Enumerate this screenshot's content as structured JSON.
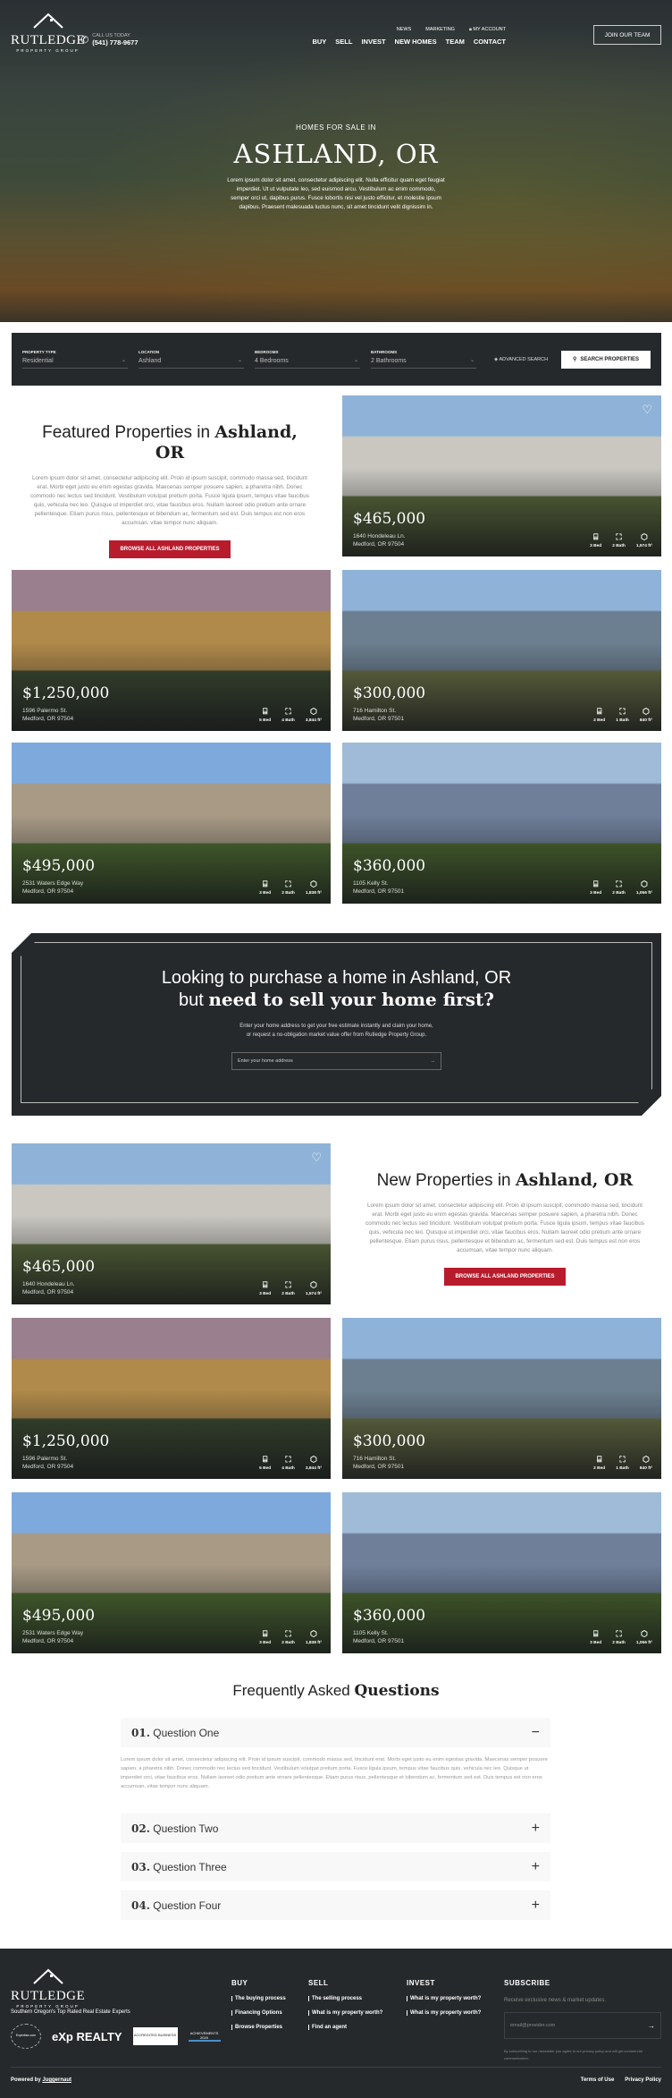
{
  "brand": {
    "name": "RUTLEDGE",
    "sub": "PROPERTY GROUP"
  },
  "header": {
    "call_label": "CALL US TODAY",
    "phone": "(541) 778-9677",
    "top_links": [
      "NEWS",
      "MARKETING",
      "MY ACCOUNT"
    ],
    "nav": [
      "BUY",
      "SELL",
      "INVEST",
      "NEW HOMES",
      "TEAM",
      "CONTACT"
    ],
    "join": "JOIN OUR TEAM"
  },
  "hero": {
    "eyebrow": "HOMES FOR SALE IN",
    "title": "ASHLAND, OR",
    "text": "Lorem ipsum dolor sit amet, consectetur adipiscing elit. Nulla efficitur quam eget feugiat imperdiet. Ut ut vulputate leo, sed euismod arcu. Vestibulum ac enim commodo, semper orci ut, dapibus purus. Fusce lobortis nisi vel justo efficitur, et molestie ipsum dapibus. Praesent malesuada luctus nunc, sit amet tincidunt velit dignissim in."
  },
  "search": {
    "fields": [
      {
        "label": "PROPERTY TYPE",
        "value": "Residential"
      },
      {
        "label": "LOCATION",
        "value": "Ashland"
      },
      {
        "label": "BEDROOMS",
        "value": "4 Bedrooms"
      },
      {
        "label": "BATHROOMS",
        "value": "2 Bathrooms"
      }
    ],
    "advanced": "ADVANCED SEARCH",
    "button": "SEARCH PROPERTIES"
  },
  "featured": {
    "title_a": "Featured Properties in ",
    "title_b": "Ashland, OR",
    "text": "Lorem ipsum dolor sit amet, consectetur adipiscing elit. Proin id ipsum suscipit, commodo massa sed, tincidunt erat. Morbi eget justo eu enim egestas gravida. Maecenas semper posuere sapien, a pharetra nibh. Donec commodo nec lectus sed tincidunt. Vestibulum volutpat pretium porta. Fusce ligula ipsum, tempus vitae faucibus quis, vehicula nec leo. Quisque ut imperdiet orci, vitae faucibus eros. Nullam laoreet odio pretium ante ornare pellentesque. Etiam purus risus, pellentesque et bibendum ac, fermentum sed est. Duis tempus est non eros accumsan, vitae tempor nunc aliquam.",
    "button": "BROWSE ALL ASHLAND PROPERTIES"
  },
  "newprops": {
    "title_a": "New Properties in ",
    "title_b": "Ashland, OR",
    "text": "Lorem ipsum dolor sit amet, consectetur adipiscing elit. Proin id ipsum suscipit, commodo massa sed, tincidunt erat. Morbi eget justo eu enim egestas gravida. Maecenas semper posuere sapien, a pharetra nibh. Donec commodo nec lectus sed tincidunt. Vestibulum volutpat pretium porta. Fusce ligula ipsum, tempus vitae faucibus quis, vehicula nec leo. Quisque ut imperdiet orci, vitae faucibus eros. Nullam laoreet odio pretium ante ornare pellentesque. Etiam purus risus, pellentesque et bibendum ac, fermentum sed est. Duis tempus est non eros accumsan, vitae tempor nunc aliquam.",
    "button": "BROWSE ALL ASHLAND PROPERTIES"
  },
  "properties": [
    {
      "price": "$465,000",
      "street": "1640 Hondeleau Ln.",
      "city": "Medford, OR 97504",
      "bed": "3 Bed",
      "bath": "2 Bath",
      "area": "1,574 ft²",
      "colors": [
        "#8fb3d8",
        "#c9c7c0",
        "#5b6b3a"
      ]
    },
    {
      "price": "$1,250,000",
      "street": "1596 Palermo St.",
      "city": "Medford, OR 97504",
      "bed": "5 Bed",
      "bath": "4 Bath",
      "area": "3,844 ft²",
      "colors": [
        "#9a7f8f",
        "#b08a4a",
        "#3c4a30"
      ]
    },
    {
      "price": "$300,000",
      "street": "716 Hamilton St.",
      "city": "Medford, OR 97501",
      "bed": "2 Bed",
      "bath": "1 Bath",
      "area": "840 ft²",
      "colors": [
        "#8fb3d8",
        "#6c7f90",
        "#6d7345"
      ]
    },
    {
      "price": "$495,000",
      "street": "2531 Waters Edge Way",
      "city": "Medford, OR 97504",
      "bed": "3 Bed",
      "bath": "2 Bath",
      "area": "1,838 ft²",
      "colors": [
        "#7ea9dc",
        "#a89a85",
        "#4f6e30"
      ]
    },
    {
      "price": "$360,000",
      "street": "1105 Kelly St.",
      "city": "Medford, OR 97501",
      "bed": "3 Bed",
      "bath": "2 Bath",
      "area": "1,056 ft²",
      "colors": [
        "#9fbbd8",
        "#6f7f9a",
        "#4d6a2e"
      ]
    }
  ],
  "cta": {
    "line1": "Looking to purchase a home in Ashland, OR",
    "line2_a": "but ",
    "line2_b": "need to sell your home first?",
    "text1": "Enter your home address to get your free estimate instantly and claim your home,",
    "text2": "or request a no-obligation market value offer from Rutledge Property Group.",
    "placeholder": "Enter your home address"
  },
  "faq": {
    "title_a": "Frequently Asked ",
    "title_b": "Questions",
    "items": [
      {
        "num": "01.",
        "q": "Question One",
        "open": true
      },
      {
        "num": "02.",
        "q": "Question Two"
      },
      {
        "num": "03.",
        "q": "Question Three"
      },
      {
        "num": "04.",
        "q": "Question Four"
      }
    ],
    "answer": "Lorem ipsum dolor sit amet, consectetur adipiscing elit. Proin id ipsum suscipit, commodo massa sed, tincidunt erat. Morbi eget justo eu enim egestas gravida. Maecenas semper posuere sapien, a pharetra nibh. Donec commodo nec lectus sed tincidunt. Vestibulum volutpat pretium porta. Fusce ligula ipsum, tempus vitae faucibus quis, vehicula nec leo. Quisque ut imperdiet orci, vitae faucibus eros. Nullam laoreet odio pretium ante ornare pellentesque. Etiam purus risus, pellentesque et bibendum ac, fermentum sed est. Duis tempus est non eros accumsan, vitae tempor nunc aliquam."
  },
  "footer": {
    "tagline": "Southern Oregon's Top Rated Real Estate Experts",
    "badges": [
      "Expertise.com",
      "eXp REALTY",
      "ACCREDITED BUSINESS",
      "ACHIEVEMENTS 2020"
    ],
    "cols": [
      {
        "title": "BUY",
        "links": [
          "The buying process",
          "Financing Options",
          "Browse Properties"
        ]
      },
      {
        "title": "SELL",
        "links": [
          "The selling process",
          "What is my property worth?",
          "Find an agent"
        ]
      },
      {
        "title": "INVEST",
        "links": [
          "What is my property worth?",
          "What is my property worth?"
        ]
      }
    ],
    "subscribe": {
      "title": "SUBSCRIBE",
      "text": "Receive exclusive news & market updates.",
      "placeholder": "email@provider.com",
      "note": "By subscribing to our newsletter you agree to our privacy policy and will get commercial communication."
    },
    "powered_a": "Powered by ",
    "powered_b": "Juggernaut",
    "legal": [
      "Terms of Use",
      "Privacy Policy"
    ]
  }
}
